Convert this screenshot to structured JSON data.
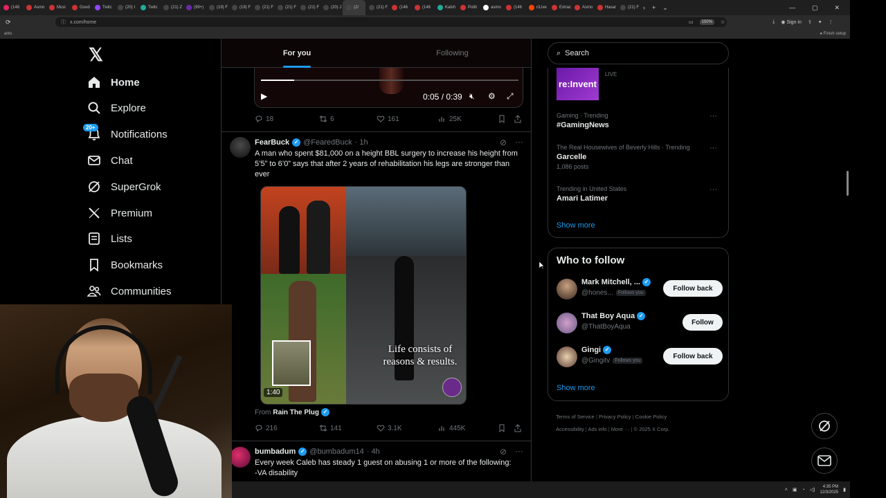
{
  "browser": {
    "tabs": [
      {
        "label": "(148"
      },
      {
        "label": "Asmo"
      },
      {
        "label": "Musi"
      },
      {
        "label": "Good"
      },
      {
        "label": "Twitc"
      },
      {
        "label": "(20) I"
      },
      {
        "label": "Twitc"
      },
      {
        "label": "(21) Z"
      },
      {
        "label": "(99+)"
      },
      {
        "label": "(19) F"
      },
      {
        "label": "(19) F"
      },
      {
        "label": "(21) F"
      },
      {
        "label": "(21) F"
      },
      {
        "label": "(21) F"
      },
      {
        "label": "(20) J"
      },
      {
        "label": "(2/"
      },
      {
        "label": "(21) F"
      },
      {
        "label": "(146"
      },
      {
        "label": "(146"
      },
      {
        "label": "Kalsh"
      },
      {
        "label": "Politi"
      },
      {
        "label": "asmo"
      },
      {
        "label": "(146"
      },
      {
        "label": "r/Live"
      },
      {
        "label": "Extrac"
      },
      {
        "label": "Asmo"
      },
      {
        "label": "Hasar"
      },
      {
        "label": "(21) F"
      }
    ],
    "url": "x.com/home",
    "zoom": "150%",
    "sign_in": "Sign in",
    "finish_setup": "Finish setup",
    "bookmarks_label": "arks"
  },
  "leftnav": {
    "items": [
      {
        "label": "Home",
        "icon": "home-icon"
      },
      {
        "label": "Explore",
        "icon": "search-icon"
      },
      {
        "label": "Notifications",
        "icon": "bell-icon",
        "badge": "20+"
      },
      {
        "label": "Chat",
        "icon": "mail-icon"
      },
      {
        "label": "SuperGrok",
        "icon": "grok-icon"
      },
      {
        "label": "Premium",
        "icon": "x-icon"
      },
      {
        "label": "Lists",
        "icon": "list-icon"
      },
      {
        "label": "Bookmarks",
        "icon": "bookmark-icon"
      },
      {
        "label": "Communities",
        "icon": "people-icon"
      }
    ]
  },
  "feed": {
    "tabs": [
      "For you",
      "Following"
    ],
    "video": {
      "time": "0:05 / 0:39",
      "progress": 0.13
    },
    "post0_actions": {
      "replies": "18",
      "reposts": "6",
      "likes": "161",
      "views": "25K"
    },
    "post1": {
      "name": "FearBuck",
      "handle": "@FearedBuck",
      "age": "· 1h",
      "text": "A man who spent $81,000 on a height BBL surgery to increase his height from 5’5” to 6’0” says that after 2 years of rehabilitation his legs are stronger than ever",
      "media_caption": "Life consists of reasons & results.",
      "media_time": "1:40",
      "from_label": "From",
      "from_name": "Rain The Plug",
      "replies": "216",
      "reposts": "141",
      "likes": "3.1K",
      "views": "445K"
    },
    "post2": {
      "name": "bumbadum",
      "handle": "@bumbadum14",
      "age": "· 4h",
      "text_line1": "Every week Caleb has steady 1 guest on abusing 1 or more of the following:",
      "text_line2": "-VA disability"
    }
  },
  "right": {
    "search_placeholder": "Search",
    "promo": {
      "brand": "re:Invent",
      "live": "LIVE"
    },
    "trends": [
      {
        "meta": "Gaming · Trending",
        "title": "#GamingNews",
        "posts": ""
      },
      {
        "meta": "The Real Housewives of Beverly Hills · Trending",
        "title": "Garcelle",
        "posts": "1,086 posts"
      },
      {
        "meta": "Trending in United States",
        "title": "Amari Latimer",
        "posts": ""
      }
    ],
    "trends_show_more": "Show more",
    "who_to_follow": {
      "title": "Who to follow",
      "accounts": [
        {
          "name": "Mark Mitchell, ...",
          "handle": "@hones...",
          "follows_you": "Follows you",
          "button": "Follow back"
        },
        {
          "name": "That Boy Aqua",
          "handle": "@ThatBoyAqua",
          "follows_you": "",
          "button": "Follow"
        },
        {
          "name": "Gingi",
          "handle": "@Gingitv",
          "follows_you": "Follows you",
          "button": "Follow back"
        }
      ],
      "show_more": "Show more"
    },
    "footer": {
      "line1": [
        "Terms of Service",
        "Privacy Policy",
        "Cookie Policy"
      ],
      "line2": [
        "Accessibility",
        "Ads info",
        "More ···",
        "© 2025 X Corp."
      ]
    }
  },
  "taskbar": {
    "time": "4:35 PM",
    "date": "12/3/2025"
  },
  "colors": {
    "accent": "#1d9bf0",
    "background": "#000000",
    "border": "#2f3336",
    "muted": "#71767b"
  }
}
